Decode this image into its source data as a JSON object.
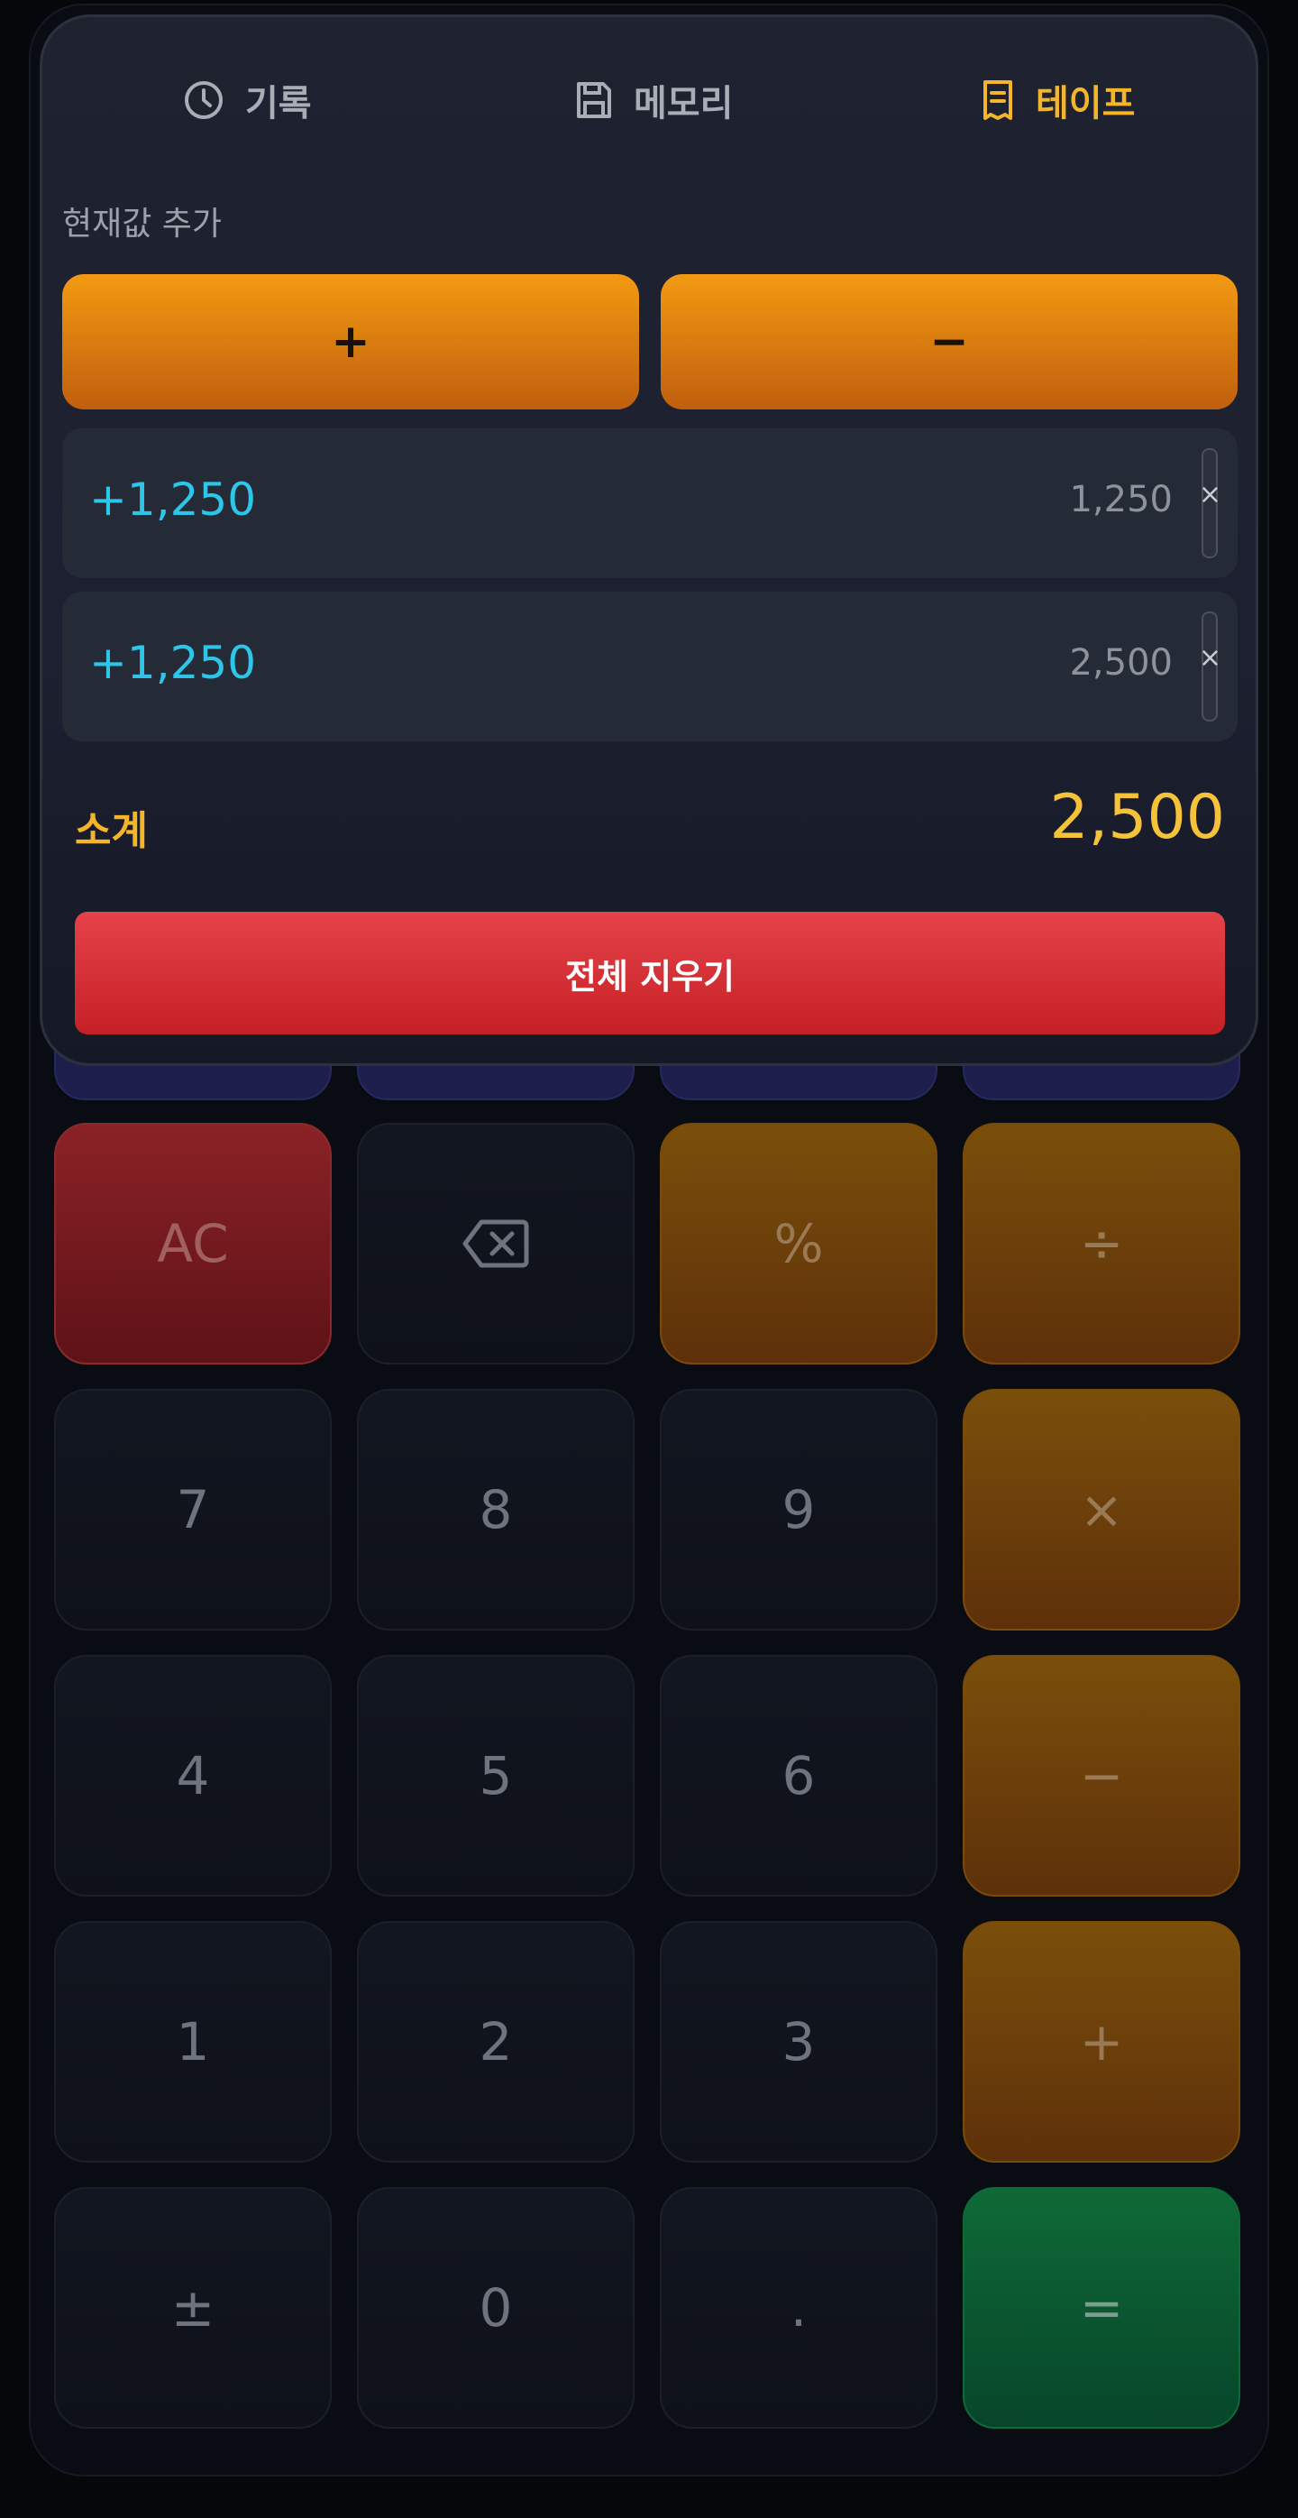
{
  "tabs": [
    {
      "label": "기록",
      "icon": "clock-icon"
    },
    {
      "label": "메모리",
      "icon": "save-icon"
    },
    {
      "label": "테이프",
      "icon": "receipt-icon",
      "active": true
    }
  ],
  "tape": {
    "add_label": "현재값 추가",
    "plus_label": "+",
    "minus_label": "−",
    "entries": [
      {
        "delta": "+1,250",
        "running": "1,250",
        "delete": "×"
      },
      {
        "delta": "+1,250",
        "running": "2,500",
        "delete": "×"
      }
    ],
    "subtotal_label": "소계",
    "subtotal_value": "2,500",
    "clear_label": "전체 지우기"
  },
  "keypad": {
    "ac": "AC",
    "percent": "%",
    "divide": "÷",
    "seven": "7",
    "eight": "8",
    "nine": "9",
    "multiply": "×",
    "four": "4",
    "five": "5",
    "six": "6",
    "minus": "−",
    "one": "1",
    "two": "2",
    "three": "3",
    "plus": "+",
    "plusminus": "±",
    "zero": "0",
    "dot": ".",
    "equals": "="
  },
  "colors": {
    "accent": "#f5b52b",
    "entry_delta": "#2ec6e8",
    "clear": "#e0363d",
    "equals": "#0e6a36"
  }
}
